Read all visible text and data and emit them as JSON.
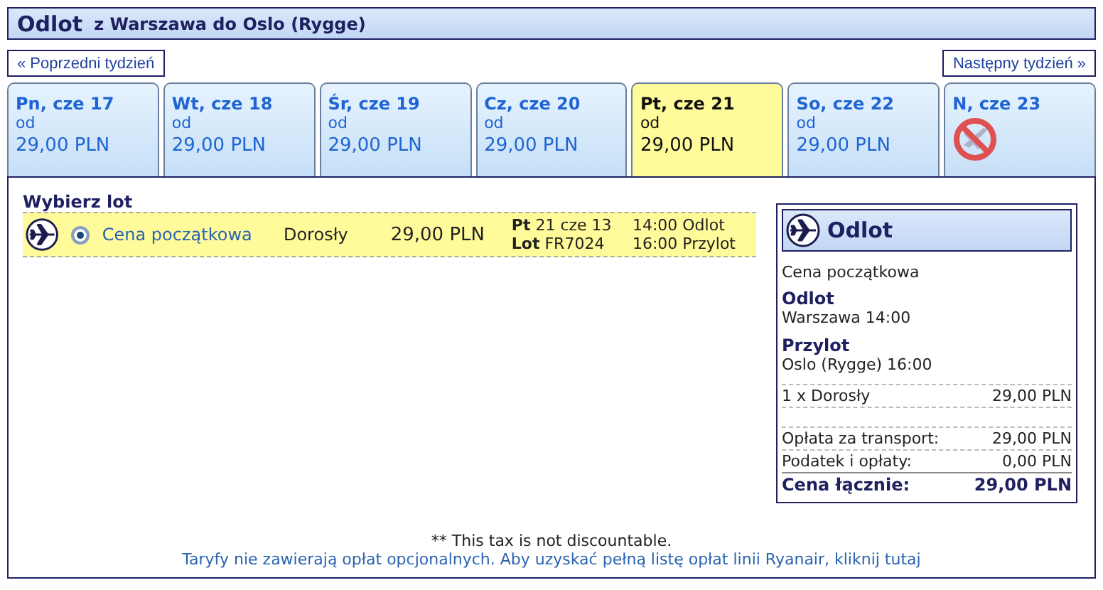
{
  "header": {
    "title": "Odlot",
    "route": "z Warszawa do Oslo (Rygge)"
  },
  "prev_week": "« Poprzedni tydzień",
  "next_week": "Następny tydzień »",
  "days": [
    {
      "label": "Pn, cze 17",
      "kind": "fare",
      "from": "od",
      "price": "29,00 PLN",
      "selected": false
    },
    {
      "label": "Wt, cze 18",
      "kind": "fare",
      "from": "od",
      "price": "29,00 PLN",
      "selected": false
    },
    {
      "label": "Śr, cze 19",
      "kind": "fare",
      "from": "od",
      "price": "29,00 PLN",
      "selected": false
    },
    {
      "label": "Cz, cze 20",
      "kind": "fare",
      "from": "od",
      "price": "29,00 PLN",
      "selected": false
    },
    {
      "label": "Pt, cze 21",
      "kind": "fare",
      "from": "od",
      "price": "29,00 PLN",
      "selected": true
    },
    {
      "label": "So, cze 22",
      "kind": "fare",
      "from": "od",
      "price": "29,00 PLN",
      "selected": false
    },
    {
      "label": "N, cze 23",
      "kind": "none",
      "selected": false
    }
  ],
  "flights": {
    "heading": "Wybierz lot",
    "rows": [
      {
        "fare": "Cena początkowa",
        "selected": true,
        "passenger": "Dorosły",
        "price": "29,00 PLN",
        "day_label": "Pt",
        "date": "21 cze 13",
        "flight_label": "Lot",
        "flight": "FR7024",
        "departure": "14:00 Odlot",
        "arrival": "16:00 Przylot"
      }
    ]
  },
  "summary": {
    "title": "Odlot",
    "fare": "Cena początkowa",
    "departure_label": "Odlot",
    "departure": "Warszawa 14:00",
    "arrival_label": "Przylot",
    "arrival": "Oslo (Rygge) 16:00",
    "lines": [
      {
        "kind": "item",
        "label": "1 x Dorosły",
        "value": "29,00 PLN"
      },
      {
        "kind": "spacer"
      },
      {
        "kind": "item",
        "label": "Opłata za transport:",
        "value": "29,00 PLN"
      },
      {
        "kind": "item",
        "label": "Podatek i opłaty:",
        "value": "0,00 PLN"
      },
      {
        "kind": "total",
        "label": "Cena łącznie:",
        "value": "29,00 PLN"
      }
    ]
  },
  "note": "** This tax is not discountable.",
  "footer_link": "Taryfy nie zawierają opłat opcjonalnych. Aby uzyskać pełną listę opłat linii Ryanair, kliknij tutaj"
}
